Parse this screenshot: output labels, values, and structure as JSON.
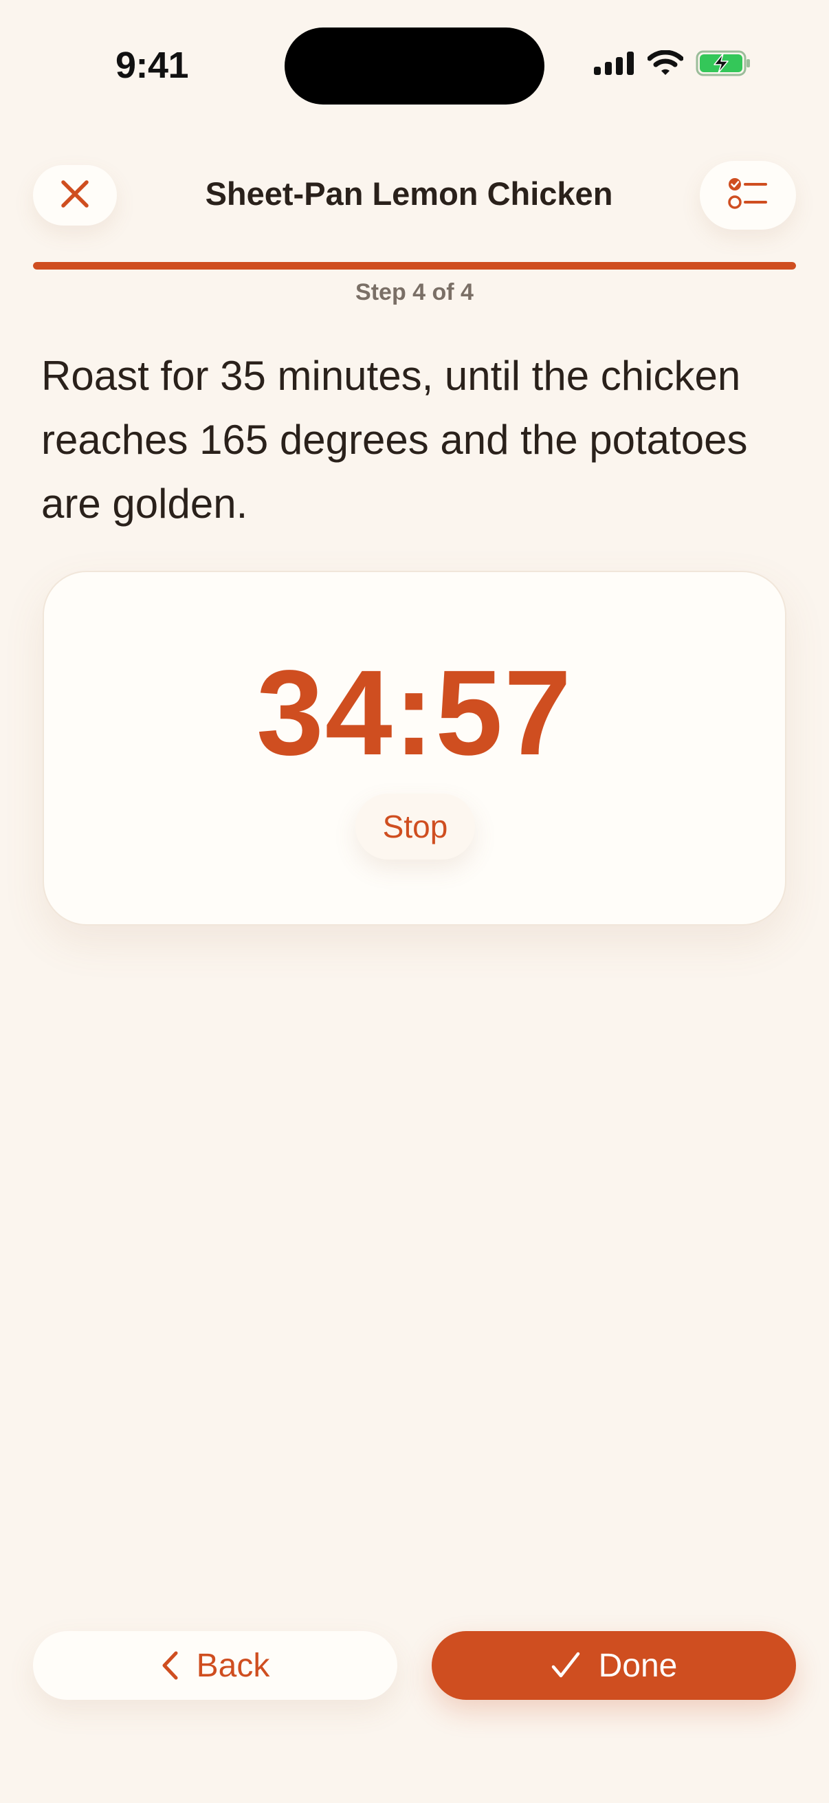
{
  "status_bar": {
    "time": "9:41"
  },
  "header": {
    "title": "Sheet-Pan Lemon Chicken",
    "close_icon": "close-icon",
    "steps_icon": "checklist-icon"
  },
  "progress": {
    "current_step": 4,
    "total_steps": 4,
    "fraction": 1.0,
    "label": "Step 4 of 4"
  },
  "instruction": {
    "text": "Roast for 35 minutes, until the chicken reaches 165 degrees and the potatoes are golden."
  },
  "timer": {
    "value": "34:57",
    "stop_label": "Stop"
  },
  "footer": {
    "back_label": "Back",
    "back_icon": "chevron-left-icon",
    "done_label": "Done",
    "done_icon": "checkmark-icon"
  },
  "colors": {
    "accent": "#cf4e20",
    "background": "#fbf5ee",
    "card": "#fffdf9",
    "text": "#2a211b",
    "muted": "#7a6f66",
    "battery_green": "#34c759"
  }
}
